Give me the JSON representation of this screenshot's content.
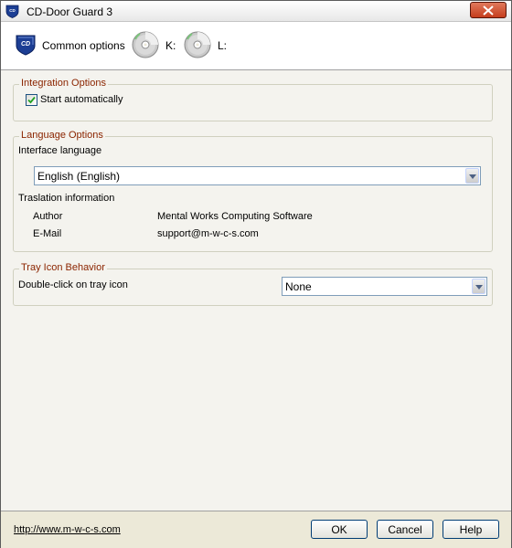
{
  "window": {
    "title": "CD-Door Guard 3"
  },
  "toolbar": {
    "common_options": "Common options",
    "drive_k": "K:",
    "drive_l": "L:"
  },
  "integration": {
    "title": "Integration Options",
    "start_auto_label": "Start automatically",
    "start_auto_checked": true
  },
  "language": {
    "title": "Language Options",
    "interface_label": "Interface language",
    "selected": "English (English)",
    "translation_info": "Traslation information",
    "author_label": "Author",
    "author_value": "Mental Works Computing Software",
    "email_label": "E-Mail",
    "email_value": "support@m-w-c-s.com"
  },
  "tray": {
    "title": "Tray Icon Behavior",
    "dblclick_label": "Double-click on tray icon",
    "dblclick_value": "None"
  },
  "footer": {
    "link": "http://www.m-w-c-s.com",
    "ok": "OK",
    "cancel": "Cancel",
    "help": "Help"
  },
  "colors": {
    "group_title": "#8B2500",
    "window_bg": "#ECE9D8",
    "content_bg": "#F4F3EE",
    "shield_blue": "#1C3E94"
  }
}
